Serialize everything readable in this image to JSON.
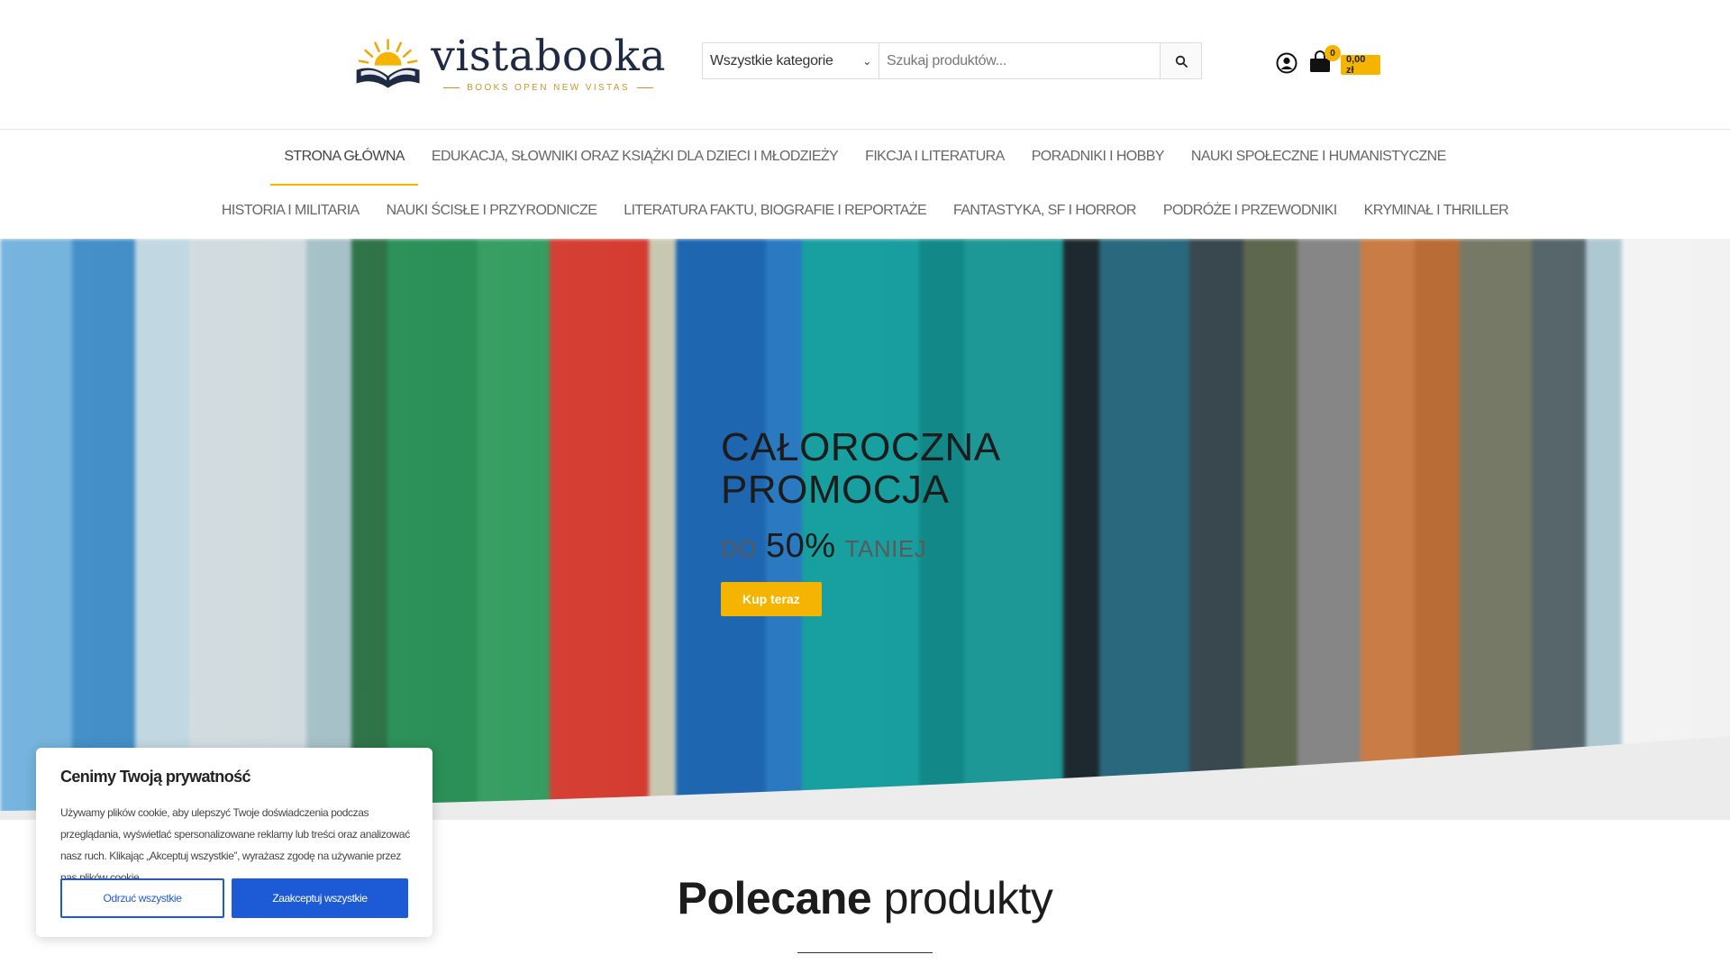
{
  "header": {
    "logo": {
      "name": "vistabooka",
      "tagline": "BOOKS OPEN NEW VISTAS"
    },
    "search": {
      "category_selected": "Wszystkie kategorie",
      "placeholder": "Szukaj produktów..."
    },
    "cart": {
      "count": "0",
      "total": "0,00 zł"
    }
  },
  "nav": {
    "row1": [
      {
        "label": "STRONA GŁÓWNA",
        "active": true
      },
      {
        "label": "EDUKACJA, SŁOWNIKI ORAZ KSIĄŻKI DLA DZIECI I MŁODZIEŻY"
      },
      {
        "label": "FIKCJA I LITERATURA"
      },
      {
        "label": "PORADNIKI I HOBBY"
      },
      {
        "label": "NAUKI SPOŁECZNE I HUMANISTYCZNE"
      }
    ],
    "row2": [
      {
        "label": "HISTORIA I MILITARIA"
      },
      {
        "label": "NAUKI ŚCISŁE I PRZYRODNICZE"
      },
      {
        "label": "LITERATURA FAKTU, BIOGRAFIE I REPORTAŻE"
      },
      {
        "label": "FANTASTYKA, SF I HORROR"
      },
      {
        "label": "PODRÓŻE I PRZEWODNIKI"
      },
      {
        "label": "KRYMINAŁ I THRILLER"
      }
    ]
  },
  "hero": {
    "title_line1": "CAŁOROCZNA",
    "title_line2": "PROMOCJA",
    "sub_prefix": "DO",
    "sub_value": "50%",
    "sub_suffix": "TANIEJ",
    "button": "Kup teraz"
  },
  "featured": {
    "title_bold": "Polecane",
    "title_rest": "produkty"
  },
  "cookie": {
    "title": "Cenimy Twoją prywatność",
    "text": "Używamy plików cookie, aby ulepszyć Twoje doświadczenia podczas przeglądania, wyświetlać spersonalizowane reklamy lub treści oraz analizować nasz ruch. Klikając „Akceptuj wszystkie”, wyrażasz zgodę na używanie przez nas plików cookie.",
    "reject": "Odrzuć wszystkie",
    "accept": "Zaakceptuj wszystkie"
  },
  "colors": {
    "accent": "#f4b400",
    "navy": "#1f2a44",
    "cookie_blue": "#1d5bd6"
  }
}
